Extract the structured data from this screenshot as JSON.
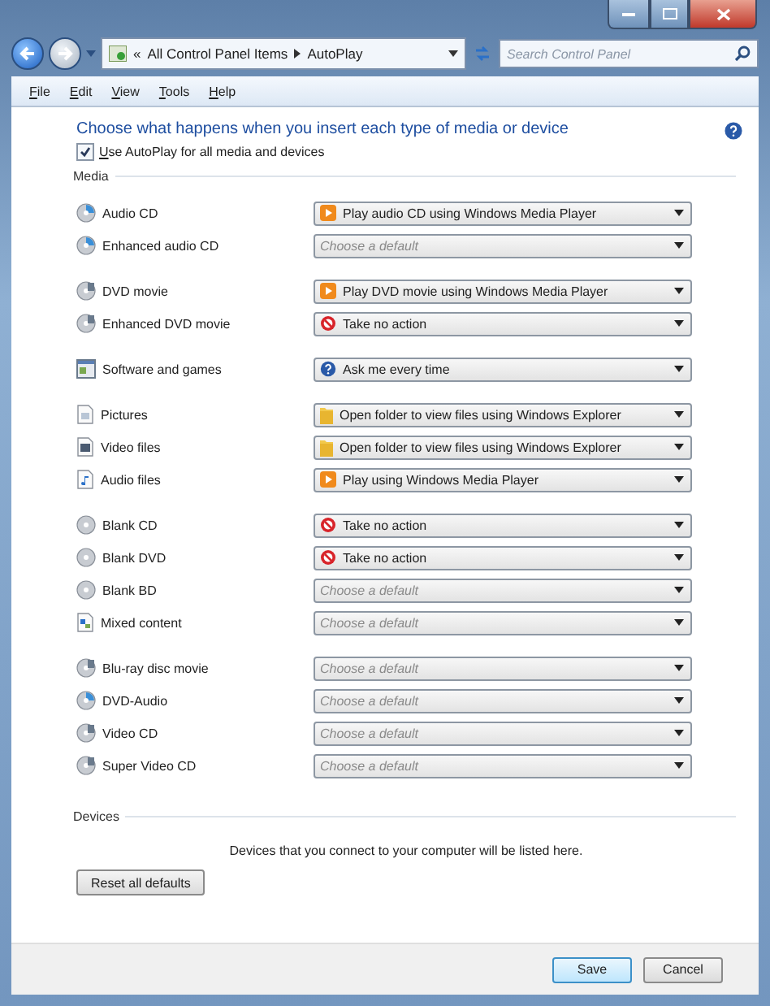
{
  "address": {
    "overflow": "«",
    "crumbs": [
      "All Control Panel Items",
      "AutoPlay"
    ]
  },
  "search": {
    "placeholder": "Search Control Panel"
  },
  "menu": [
    "File",
    "Edit",
    "View",
    "Tools",
    "Help"
  ],
  "heading": "Choose what happens when you insert each type of media or device",
  "autoplay": {
    "label": "Use AutoPlay for all media and devices",
    "checked": true
  },
  "media_title": "Media",
  "groups": [
    [
      {
        "label": "Audio CD",
        "kind": "cd",
        "choice": {
          "kind": "player",
          "text": "Play audio CD using Windows Media Player"
        }
      },
      {
        "label": "Enhanced audio CD",
        "kind": "cd",
        "choice": {
          "kind": "placeholder",
          "text": "Choose a default"
        }
      }
    ],
    [
      {
        "label": "DVD movie",
        "kind": "dvd",
        "choice": {
          "kind": "player",
          "text": "Play DVD movie using Windows Media Player"
        }
      },
      {
        "label": "Enhanced DVD movie",
        "kind": "dvd",
        "choice": {
          "kind": "none",
          "text": "Take no action"
        }
      }
    ],
    [
      {
        "label": "Software and games",
        "kind": "software",
        "choice": {
          "kind": "ask",
          "text": "Ask me every time"
        }
      }
    ],
    [
      {
        "label": "Pictures",
        "kind": "picture",
        "choice": {
          "kind": "folder",
          "text": "Open folder to view files using Windows Explorer"
        }
      },
      {
        "label": "Video files",
        "kind": "video",
        "choice": {
          "kind": "folder",
          "text": "Open folder to view files using Windows Explorer"
        }
      },
      {
        "label": "Audio files",
        "kind": "audio",
        "choice": {
          "kind": "player",
          "text": "Play using Windows Media Player"
        }
      }
    ],
    [
      {
        "label": "Blank CD",
        "kind": "blank",
        "choice": {
          "kind": "none",
          "text": "Take no action"
        }
      },
      {
        "label": "Blank DVD",
        "kind": "blank",
        "choice": {
          "kind": "none",
          "text": "Take no action"
        }
      },
      {
        "label": "Blank BD",
        "kind": "blank",
        "choice": {
          "kind": "placeholder",
          "text": "Choose a default"
        }
      },
      {
        "label": "Mixed content",
        "kind": "mixed",
        "choice": {
          "kind": "placeholder",
          "text": "Choose a default"
        }
      }
    ],
    [
      {
        "label": "Blu-ray disc movie",
        "kind": "dvd",
        "choice": {
          "kind": "placeholder",
          "text": "Choose a default"
        }
      },
      {
        "label": "DVD-Audio",
        "kind": "cd",
        "choice": {
          "kind": "placeholder",
          "text": "Choose a default"
        }
      },
      {
        "label": "Video CD",
        "kind": "dvd",
        "choice": {
          "kind": "placeholder",
          "text": "Choose a default"
        }
      },
      {
        "label": "Super Video CD",
        "kind": "dvd",
        "choice": {
          "kind": "placeholder",
          "text": "Choose a default"
        }
      }
    ]
  ],
  "devices_title": "Devices",
  "devices_note": "Devices that you connect to your computer will be listed here.",
  "reset_button": "Reset all defaults",
  "buttons": [
    {
      "label": "Save",
      "kind": "default"
    },
    {
      "label": "Cancel",
      "kind": "normal"
    }
  ]
}
